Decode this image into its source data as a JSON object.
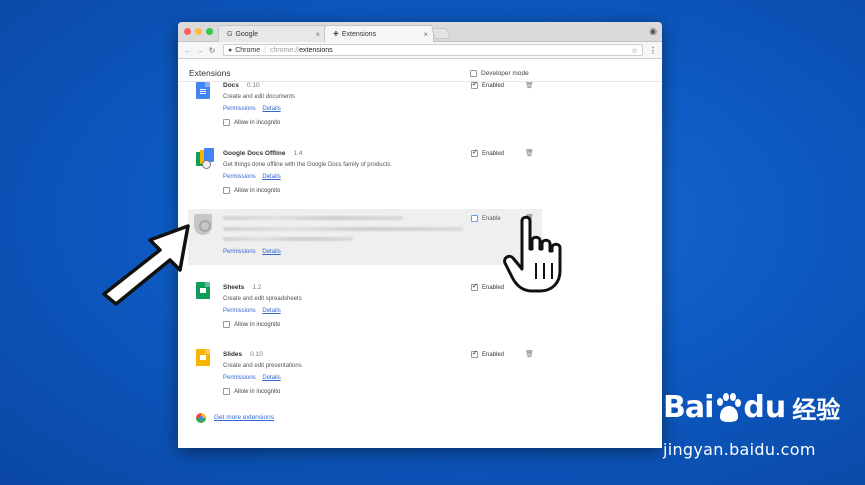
{
  "browser": {
    "tabs": [
      {
        "label": "Google",
        "icon": "google-g-icon"
      },
      {
        "label": "Extensions",
        "icon": "puzzle-icon"
      }
    ],
    "omnibox": {
      "scheme_label": "Chrome",
      "host": "chrome://",
      "path": "extensions"
    }
  },
  "page": {
    "title": "Extensions",
    "developer_mode_label": "Developer mode",
    "developer_mode_checked": false
  },
  "extensions": [
    {
      "name": "Docs",
      "version": "0.10",
      "description": "Create and edit documents",
      "permissions_label": "Permissions",
      "details_label": "Details",
      "incognito_label": "Allow in incognito",
      "status_label": "Enabled",
      "enabled": true
    },
    {
      "name": "Google Docs Offline",
      "version": "1.4",
      "description": "Get things done offline with the Google Docs family of products.",
      "permissions_label": "Permissions",
      "details_label": "Details",
      "incognito_label": "Allow in incognito",
      "status_label": "Enabled",
      "enabled": true
    },
    {
      "name": "",
      "version": "",
      "description": "",
      "permissions_label": "Permissions",
      "details_label": "Details",
      "status_label": "Enable",
      "enabled": false
    },
    {
      "name": "Sheets",
      "version": "1.2",
      "description": "Create and edit spreadsheets",
      "permissions_label": "Permissions",
      "details_label": "Details",
      "incognito_label": "Allow in incognito",
      "status_label": "Enabled",
      "enabled": true
    },
    {
      "name": "Slides",
      "version": "0.10",
      "description": "Create and edit presentations",
      "permissions_label": "Permissions",
      "details_label": "Details",
      "incognito_label": "Allow in incognito",
      "status_label": "Enabled",
      "enabled": true
    }
  ],
  "footer": {
    "more_extensions_label": "Get more extensions"
  },
  "watermark": {
    "brand_latin": "Bai",
    "brand_du": "du",
    "brand_cn": "经验",
    "url": "jingyan.baidu.com"
  },
  "colors": {
    "desktop": "#0d5bc4",
    "link": "#3367d6",
    "docs": "#4285f4",
    "sheets": "#0f9d58",
    "slides": "#f4b400"
  }
}
